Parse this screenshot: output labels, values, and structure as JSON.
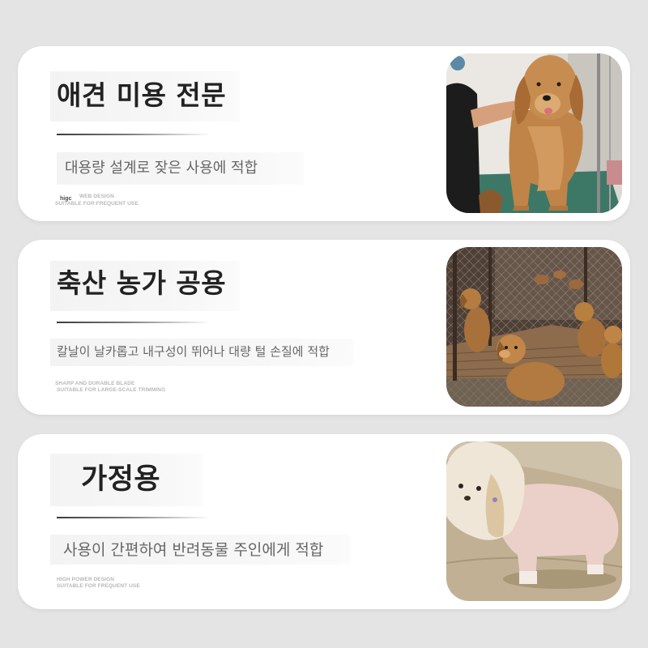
{
  "colors": {
    "page_background": "#e4e4e4",
    "card_background": "#ffffff",
    "title_text": "#222222",
    "subtitle_text": "#666666",
    "caption_text": "#b8b8b8",
    "caption_mark": "#4a4a4a",
    "divider": "#3c3c3c",
    "text_panel": "#f3f3f3"
  },
  "cards": [
    {
      "title": "애견 미용 전문",
      "subtitle": "대용량 설계로 잦은 사용에 적합",
      "caption_mark": "higc",
      "caption_line1": "WEB DESIGN",
      "caption_line2": "SUITABLE FOR FREQUENT USE"
    },
    {
      "title": "축산 농가 공용",
      "subtitle": "칼날이 날카롭고 내구성이 뛰어나 대량 털 손질에 적합",
      "caption_line1": "SHARP AND DURABLE BLADE",
      "caption_line2": "SUITABLE FOR LARGE-SCALE TRIMMING"
    },
    {
      "title": "가정용",
      "subtitle": "사용이 간편하여 반려동물 주인에게 적합",
      "caption_line1": "HIGH POWER DESIGN",
      "caption_line2": "SUITABLE FOR FREQUENT USE"
    }
  ]
}
